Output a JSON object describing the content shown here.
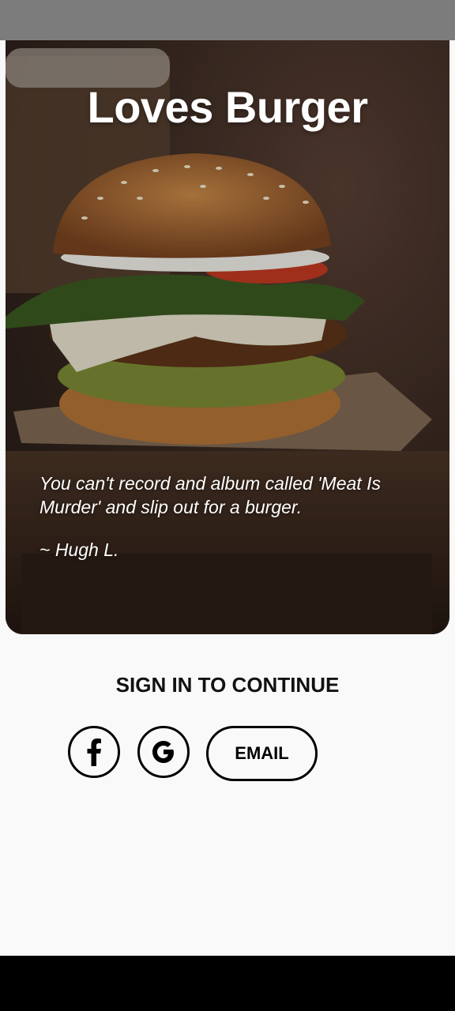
{
  "hero": {
    "title": "Loves Burger",
    "quote": "You can't record and album called 'Meat Is Murder' and slip out for a burger.",
    "author": "~ Hugh L."
  },
  "auth": {
    "heading": "SIGN IN TO CONTINUE",
    "facebook_icon": "facebook-icon",
    "google_icon": "google-icon",
    "email_label": "EMAIL"
  },
  "colors": {
    "background": "#f9f9f9",
    "status_bar": "#7c7c7c",
    "nav_bar": "#000000",
    "button_border": "#000000"
  }
}
